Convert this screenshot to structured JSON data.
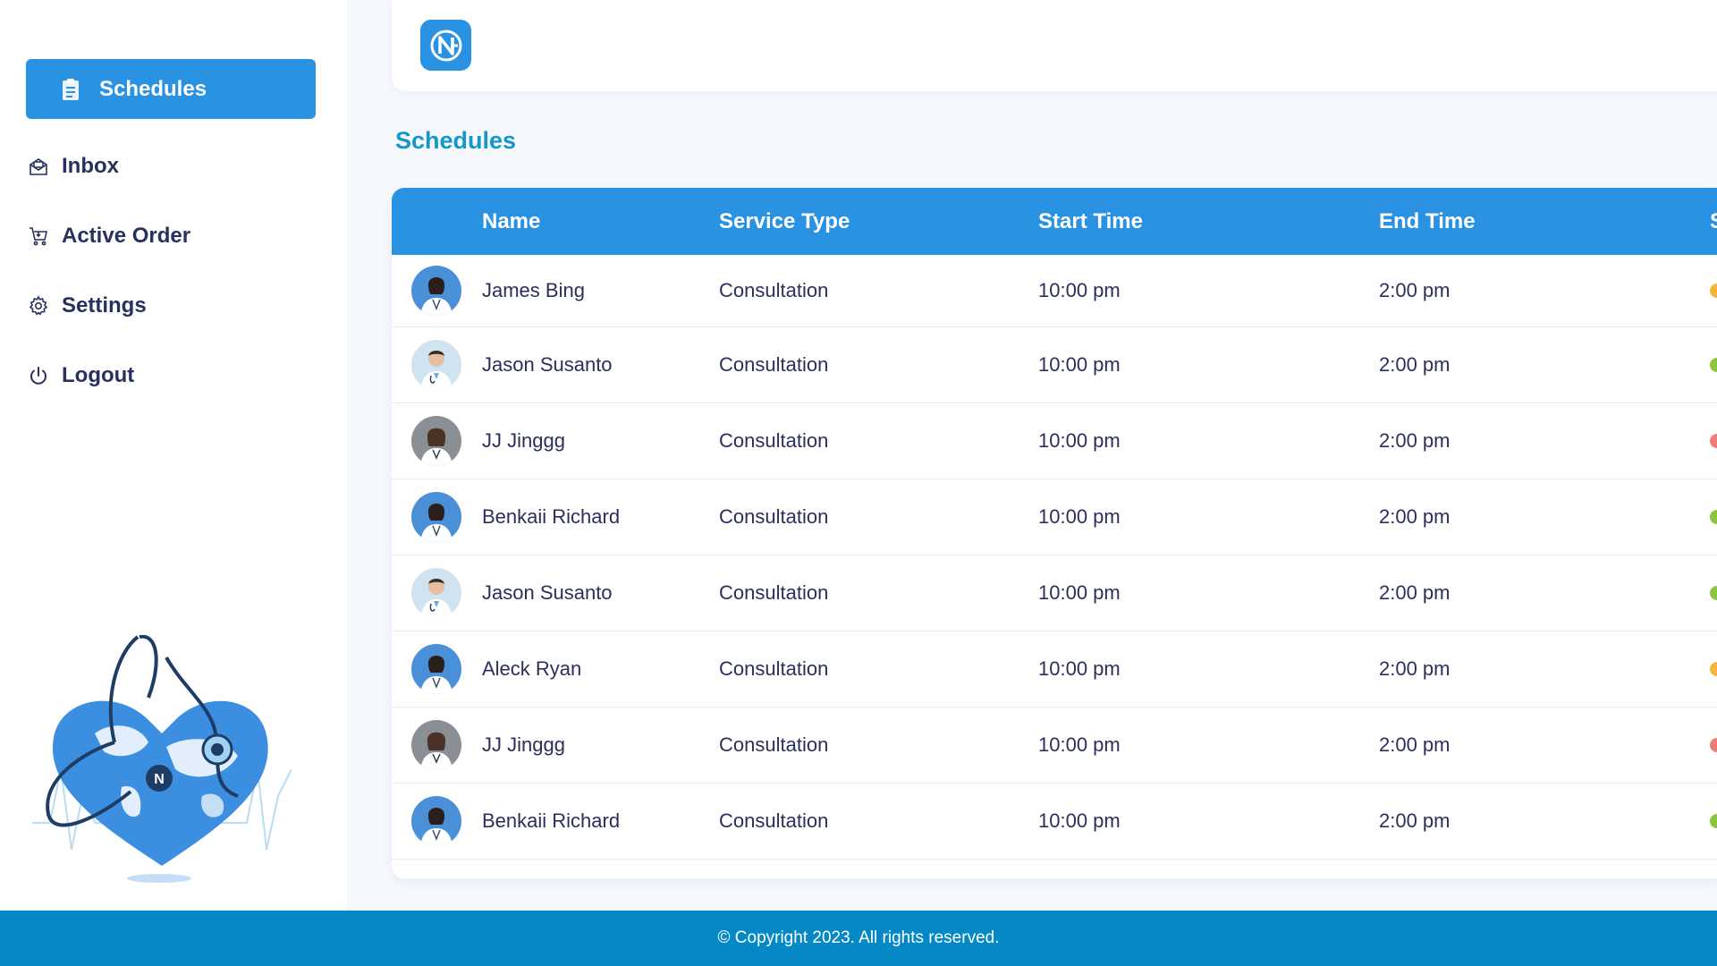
{
  "sidebar": {
    "items": [
      {
        "label": "Schedules",
        "icon": "clipboard-icon",
        "active": true
      },
      {
        "label": "Inbox",
        "icon": "inbox-icon",
        "active": false
      },
      {
        "label": "Active Order",
        "icon": "cart-icon",
        "active": false
      },
      {
        "label": "Settings",
        "icon": "gear-icon",
        "active": false
      },
      {
        "label": "Logout",
        "icon": "power-icon",
        "active": false
      }
    ]
  },
  "page": {
    "title": "Schedules"
  },
  "table": {
    "headers": [
      "Name",
      "Service Type",
      "Start Time",
      "End Time",
      "S"
    ],
    "rows": [
      {
        "name": "James Bing",
        "service": "Consultation",
        "start": "10:00 pm",
        "end": "2:00 pm",
        "status_color": "#f4b63f",
        "avatar": "female-doctor"
      },
      {
        "name": "Jason Susanto",
        "service": "Consultation",
        "start": "10:00 pm",
        "end": "2:00 pm",
        "status_color": "#8cc63f",
        "avatar": "male-doctor"
      },
      {
        "name": "JJ Jinggg",
        "service": "Consultation",
        "start": "10:00 pm",
        "end": "2:00 pm",
        "status_color": "#f07b7b",
        "avatar": "female-doctor-gray"
      },
      {
        "name": "Benkaii Richard",
        "service": "Consultation",
        "start": "10:00 pm",
        "end": "2:00 pm",
        "status_color": "#8cc63f",
        "avatar": "female-doctor"
      },
      {
        "name": "Jason Susanto",
        "service": "Consultation",
        "start": "10:00 pm",
        "end": "2:00 pm",
        "status_color": "#8cc63f",
        "avatar": "male-doctor"
      },
      {
        "name": "Aleck Ryan",
        "service": "Consultation",
        "start": "10:00 pm",
        "end": "2:00 pm",
        "status_color": "#f4b63f",
        "avatar": "female-doctor"
      },
      {
        "name": "JJ Jinggg",
        "service": "Consultation",
        "start": "10:00 pm",
        "end": "2:00 pm",
        "status_color": "#f07b7b",
        "avatar": "female-doctor-gray"
      },
      {
        "name": "Benkaii Richard",
        "service": "Consultation",
        "start": "10:00 pm",
        "end": "2:00 pm",
        "status_color": "#8cc63f",
        "avatar": "female-doctor"
      }
    ]
  },
  "footer": {
    "text": "© Copyright 2023. All rights reserved."
  },
  "colors": {
    "primary": "#2a92e3",
    "title": "#1597c9",
    "footer": "#0589c6"
  }
}
